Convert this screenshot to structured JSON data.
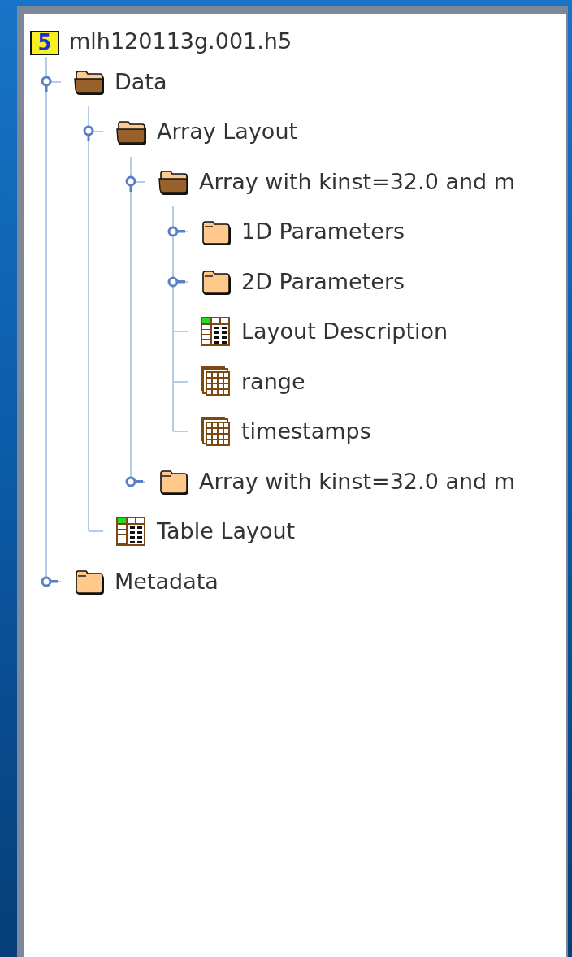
{
  "tree": {
    "root": {
      "label": "mlh120113g.001.h5",
      "kind": "file",
      "glyph": "5",
      "children": [
        {
          "label": "Data",
          "kind": "group",
          "expanded": true,
          "children": [
            {
              "label": "Array Layout",
              "kind": "group",
              "expanded": true,
              "children": [
                {
                  "label": "Array with kinst=32.0 and m",
                  "kind": "group",
                  "expanded": true,
                  "children": [
                    {
                      "label": "1D Parameters",
                      "kind": "group",
                      "expanded": false
                    },
                    {
                      "label": "2D Parameters",
                      "kind": "group",
                      "expanded": false
                    },
                    {
                      "label": "Layout Description",
                      "kind": "table"
                    },
                    {
                      "label": "range",
                      "kind": "dataset"
                    },
                    {
                      "label": "timestamps",
                      "kind": "dataset"
                    }
                  ]
                },
                {
                  "label": "Array with kinst=32.0 and m",
                  "kind": "group",
                  "expanded": false
                }
              ]
            },
            {
              "label": "Table Layout",
              "kind": "table"
            }
          ]
        },
        {
          "label": "Metadata",
          "kind": "group",
          "expanded": false
        }
      ]
    }
  }
}
